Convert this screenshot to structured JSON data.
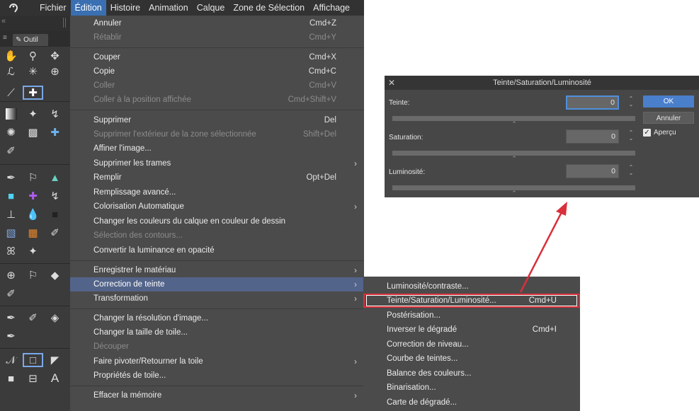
{
  "menubar": {
    "items": [
      "Fichier",
      "Édition",
      "Histoire",
      "Animation",
      "Calque",
      "Zone de Sélection",
      "Affichage"
    ]
  },
  "toolpanel": {
    "tab_label": "Outil"
  },
  "edit_menu": {
    "undo": {
      "label": "Annuler",
      "shortcut": "Cmd+Z"
    },
    "redo": {
      "label": "Rétablir",
      "shortcut": "Cmd+Y"
    },
    "cut": {
      "label": "Couper",
      "shortcut": "Cmd+X"
    },
    "copy": {
      "label": "Copie",
      "shortcut": "Cmd+C"
    },
    "paste": {
      "label": "Coller",
      "shortcut": "Cmd+V"
    },
    "paste_at_position": {
      "label": "Coller à la position affichée",
      "shortcut": "Cmd+Shift+V"
    },
    "delete": {
      "label": "Supprimer",
      "shortcut": "Del"
    },
    "delete_outside": {
      "label": "Supprimer l'extérieur de la zone sélectionnée",
      "shortcut": "Shift+Del"
    },
    "refine": {
      "label": "Affiner l'image..."
    },
    "delete_tones": {
      "label": "Supprimer les trames"
    },
    "fill": {
      "label": "Remplir",
      "shortcut": "Opt+Del"
    },
    "advanced_fill": {
      "label": "Remplissage avancé..."
    },
    "auto_color": {
      "label": "Colorisation Automatique"
    },
    "change_layer_color": {
      "label": "Changer les couleurs du calque en couleur de dessin"
    },
    "select_outline": {
      "label": "Sélection des contours..."
    },
    "luminance_opacity": {
      "label": "Convertir la luminance en opacité"
    },
    "register_material": {
      "label": "Enregistrer le matériau"
    },
    "tonal_correction": {
      "label": "Correction de teinte"
    },
    "transform": {
      "label": "Transformation"
    },
    "change_resolution": {
      "label": "Changer la résolution d'image..."
    },
    "change_canvas_size": {
      "label": "Changer la taille de toile..."
    },
    "crop": {
      "label": "Découper"
    },
    "rotate_flip": {
      "label": "Faire pivoter/Retourner la toile"
    },
    "canvas_properties": {
      "label": "Propriétés de toile..."
    },
    "clear_memory": {
      "label": "Effacer la mémoire"
    }
  },
  "submenu": {
    "items": [
      {
        "label": "Luminosité/contraste...",
        "shortcut": ""
      },
      {
        "label": "Teinte/Saturation/Luminosité...",
        "shortcut": "Cmd+U"
      },
      {
        "label": "Postérisation...",
        "shortcut": ""
      },
      {
        "label": "Inverser le dégradé",
        "shortcut": "Cmd+I"
      },
      {
        "label": "Correction de niveau...",
        "shortcut": ""
      },
      {
        "label": "Courbe de teintes...",
        "shortcut": ""
      },
      {
        "label": "Balance des couleurs...",
        "shortcut": ""
      },
      {
        "label": "Binarisation...",
        "shortcut": ""
      },
      {
        "label": "Carte de dégradé...",
        "shortcut": ""
      }
    ]
  },
  "dialog": {
    "title": "Teinte/Saturation/Luminosité",
    "hue_label": "Teinte:",
    "hue_value": "0",
    "saturation_label": "Saturation:",
    "saturation_value": "0",
    "luminosity_label": "Luminosité:",
    "luminosity_value": "0",
    "ok_label": "OK",
    "cancel_label": "Annuler",
    "preview_label": "Aperçu",
    "preview_checked": true
  },
  "colors": {
    "menu_bg": "#4b4b4b",
    "highlight": "#53648a",
    "accent": "#4a7fcb",
    "annotation_red": "#d9303a"
  }
}
